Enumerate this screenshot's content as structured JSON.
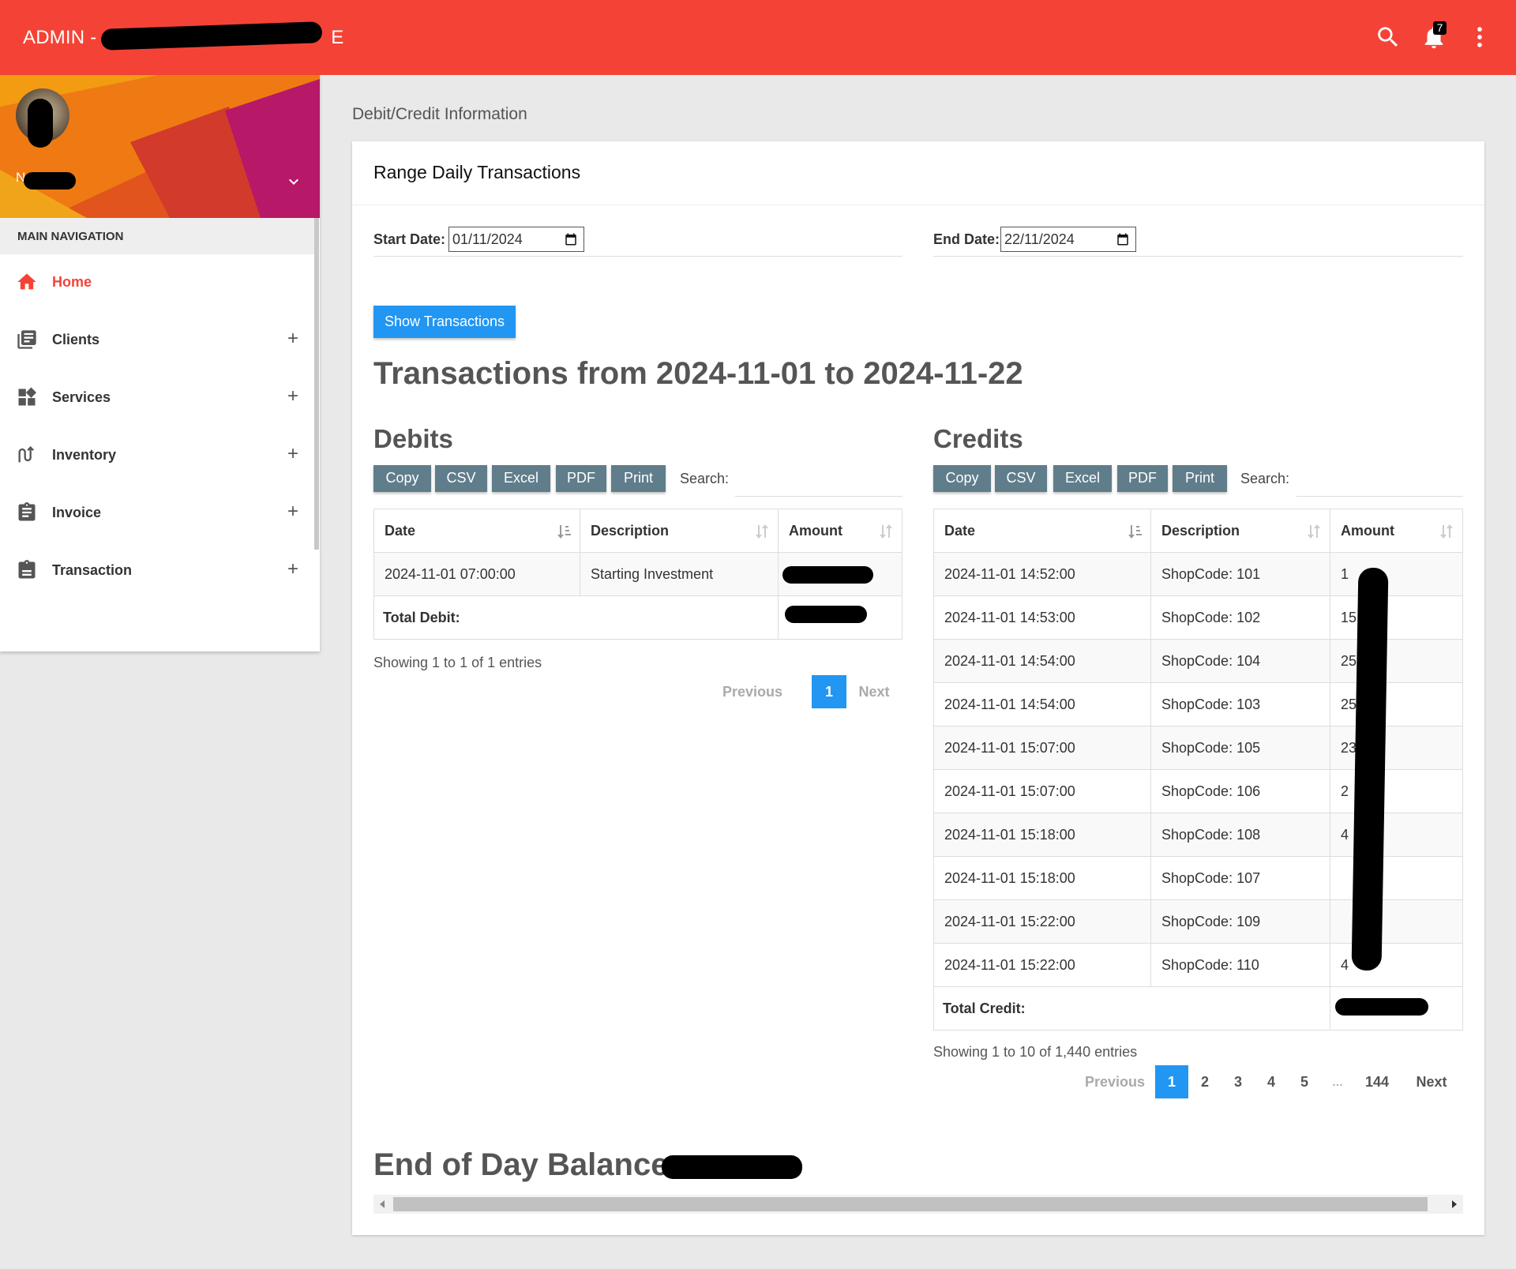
{
  "topbar": {
    "brand": "ADMIN - ",
    "brand_tail": "E",
    "notification_count": "7",
    "accent_color": "#f44336"
  },
  "sidebar": {
    "user_initial": "N",
    "nav_header": "MAIN NAVIGATION",
    "items": [
      {
        "label": "Home",
        "icon": "home-icon",
        "active": true
      },
      {
        "label": "Clients",
        "icon": "clients-icon",
        "expand": "+"
      },
      {
        "label": "Services",
        "icon": "services-icon",
        "expand": "+"
      },
      {
        "label": "Inventory",
        "icon": "inventory-icon",
        "expand": "+"
      },
      {
        "label": "Invoice",
        "icon": "invoice-icon",
        "expand": "+"
      },
      {
        "label": "Transaction",
        "icon": "transaction-icon",
        "expand": "+"
      }
    ]
  },
  "breadcrumb": "Debit/Credit Information",
  "card": {
    "title": "Range Daily Transactions",
    "start_label": "Start Date:",
    "start_value": "01/11/2024",
    "end_label": "End Date:",
    "end_value": "22/11/2024",
    "show_button": "Show Transactions",
    "range_heading": "Transactions from 2024-11-01 to 2024-11-22",
    "balance_heading": "End of Day Balance:"
  },
  "export_buttons": [
    "Copy",
    "CSV",
    "Excel",
    "PDF",
    "Print"
  ],
  "search_label": "Search:",
  "debits": {
    "heading": "Debits",
    "columns": [
      "Date",
      "Description",
      "Amount"
    ],
    "rows": [
      {
        "date": "2024-11-01 07:00:00",
        "description": "Starting Investment"
      }
    ],
    "total_label": "Total Debit:",
    "info": "Showing 1 to 1 of 1 entries",
    "pagination": {
      "previous": "Previous",
      "pages": [
        "1"
      ],
      "next": "Next"
    }
  },
  "credits": {
    "heading": "Credits",
    "columns": [
      "Date",
      "Description",
      "Amount"
    ],
    "rows": [
      {
        "date": "2024-11-01 14:52:00",
        "description": "ShopCode: 101",
        "amount": "1"
      },
      {
        "date": "2024-11-01 14:53:00",
        "description": "ShopCode: 102",
        "amount": "15"
      },
      {
        "date": "2024-11-01 14:54:00",
        "description": "ShopCode: 104",
        "amount": "25"
      },
      {
        "date": "2024-11-01 14:54:00",
        "description": "ShopCode: 103",
        "amount": "25"
      },
      {
        "date": "2024-11-01 15:07:00",
        "description": "ShopCode: 105",
        "amount": "23"
      },
      {
        "date": "2024-11-01 15:07:00",
        "description": "ShopCode: 106",
        "amount": "2"
      },
      {
        "date": "2024-11-01 15:18:00",
        "description": "ShopCode: 108",
        "amount": "4"
      },
      {
        "date": "2024-11-01 15:18:00",
        "description": "ShopCode: 107",
        "amount": ""
      },
      {
        "date": "2024-11-01 15:22:00",
        "description": "ShopCode: 109",
        "amount": ""
      },
      {
        "date": "2024-11-01 15:22:00",
        "description": "ShopCode: 110",
        "amount": "4"
      }
    ],
    "total_label": "Total Credit:",
    "info": "Showing 1 to 10 of 1,440 entries",
    "pagination": {
      "previous": "Previous",
      "pages": [
        "1",
        "2",
        "3",
        "4",
        "5",
        "…",
        "144"
      ],
      "next": "Next"
    }
  }
}
